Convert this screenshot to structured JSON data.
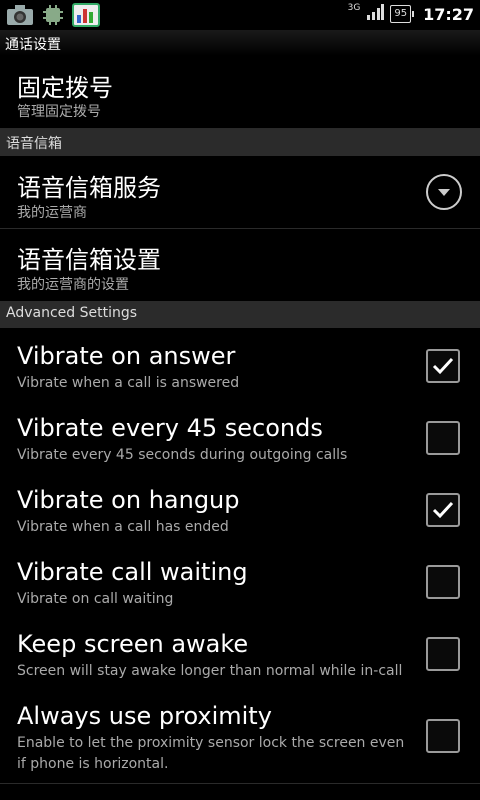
{
  "status_bar": {
    "network": "3G",
    "battery": "95",
    "time": "17:27",
    "icons": [
      "camera-icon",
      "android-debug-icon",
      "chart-app-icon",
      "signal-icon"
    ]
  },
  "title": "通话设置",
  "fixed_dialing": {
    "title": "固定拨号",
    "summary": "管理固定拨号"
  },
  "voicemail_header": "语音信箱",
  "voicemail_service": {
    "title": "语音信箱服务",
    "summary": "我的运营商"
  },
  "voicemail_settings": {
    "title": "语音信箱设置",
    "summary": "我的运营商的设置"
  },
  "advanced_header": "Advanced Settings",
  "advanced_items": [
    {
      "title": "Vibrate on answer",
      "summary": "Vibrate when a call is answered",
      "checked": true
    },
    {
      "title": "Vibrate every 45 seconds",
      "summary": "Vibrate every 45 seconds during outgoing calls",
      "checked": false
    },
    {
      "title": "Vibrate on hangup",
      "summary": "Vibrate when a call has ended",
      "checked": true
    },
    {
      "title": "Vibrate call waiting",
      "summary": "Vibrate on call waiting",
      "checked": false
    },
    {
      "title": "Keep screen awake",
      "summary": "Screen will stay awake longer than normal while in-call",
      "checked": false
    },
    {
      "title": "Always use proximity",
      "summary_line1": "Enable to let the proximity sensor lock the screen even",
      "summary_line2": "if phone is horizontal.",
      "checked": false
    }
  ]
}
